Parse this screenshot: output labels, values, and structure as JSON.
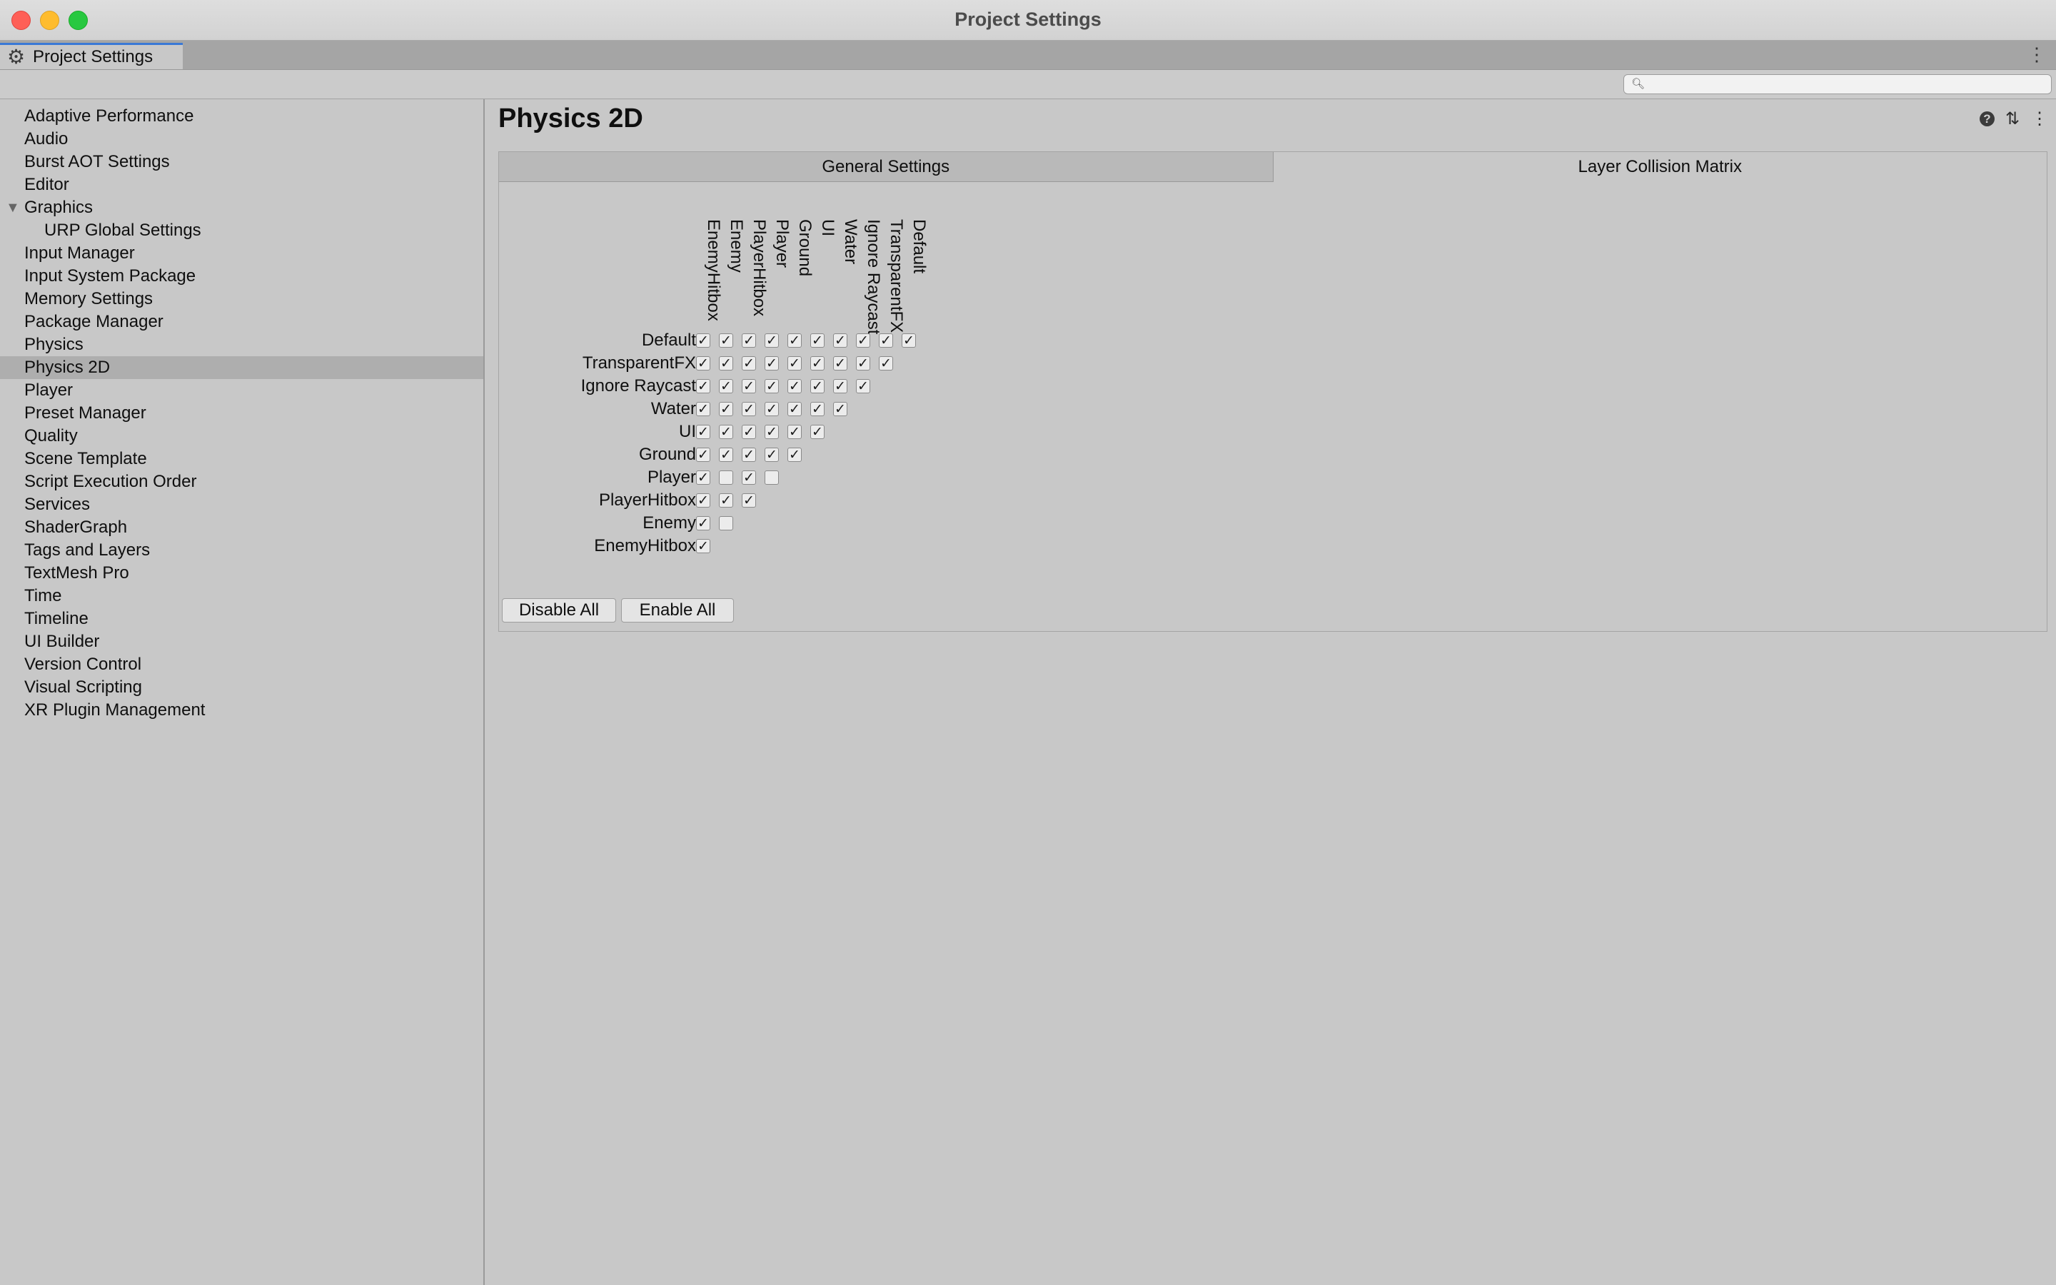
{
  "window": {
    "title": "Project Settings"
  },
  "tab": {
    "label": "Project Settings",
    "icon": "gear-icon"
  },
  "search": {
    "value": "",
    "placeholder": ""
  },
  "sidebar": {
    "items": [
      {
        "label": "Adaptive Performance",
        "level": 0
      },
      {
        "label": "Audio",
        "level": 0
      },
      {
        "label": "Burst AOT Settings",
        "level": 0
      },
      {
        "label": "Editor",
        "level": 0
      },
      {
        "label": "Graphics",
        "level": 0,
        "expanded": true
      },
      {
        "label": "URP Global Settings",
        "level": 1
      },
      {
        "label": "Input Manager",
        "level": 0
      },
      {
        "label": "Input System Package",
        "level": 0
      },
      {
        "label": "Memory Settings",
        "level": 0
      },
      {
        "label": "Package Manager",
        "level": 0
      },
      {
        "label": "Physics",
        "level": 0
      },
      {
        "label": "Physics 2D",
        "level": 0,
        "selected": true
      },
      {
        "label": "Player",
        "level": 0
      },
      {
        "label": "Preset Manager",
        "level": 0
      },
      {
        "label": "Quality",
        "level": 0
      },
      {
        "label": "Scene Template",
        "level": 0
      },
      {
        "label": "Script Execution Order",
        "level": 0
      },
      {
        "label": "Services",
        "level": 0
      },
      {
        "label": "ShaderGraph",
        "level": 0
      },
      {
        "label": "Tags and Layers",
        "level": 0
      },
      {
        "label": "TextMesh Pro",
        "level": 0
      },
      {
        "label": "Time",
        "level": 0
      },
      {
        "label": "Timeline",
        "level": 0
      },
      {
        "label": "UI Builder",
        "level": 0
      },
      {
        "label": "Version Control",
        "level": 0
      },
      {
        "label": "Visual Scripting",
        "level": 0
      },
      {
        "label": "XR Plugin Management",
        "level": 0
      }
    ]
  },
  "main": {
    "title": "Physics 2D",
    "header_icons": [
      "help-icon",
      "presets-icon",
      "more-icon"
    ],
    "tabs": [
      {
        "label": "General Settings",
        "active": false
      },
      {
        "label": "Layer Collision Matrix",
        "active": true
      }
    ],
    "matrix": {
      "layers": [
        "Default",
        "TransparentFX",
        "Ignore Raycast",
        "Water",
        "UI",
        "Ground",
        "Player",
        "PlayerHitbox",
        "Enemy",
        "EnemyHitbox"
      ],
      "columns": [
        "EnemyHitbox",
        "Enemy",
        "PlayerHitbox",
        "Player",
        "Ground",
        "UI",
        "Water",
        "Ignore Raycast",
        "TransparentFX",
        "Default"
      ],
      "rows": [
        [
          true,
          true,
          true,
          true,
          true,
          true,
          true,
          true,
          true,
          true
        ],
        [
          true,
          true,
          true,
          true,
          true,
          true,
          true,
          true,
          true
        ],
        [
          true,
          true,
          true,
          true,
          true,
          true,
          true,
          true
        ],
        [
          true,
          true,
          true,
          true,
          true,
          true,
          true
        ],
        [
          true,
          true,
          true,
          true,
          true,
          true
        ],
        [
          true,
          true,
          true,
          true,
          true
        ],
        [
          true,
          false,
          true,
          false
        ],
        [
          true,
          true,
          true
        ],
        [
          true,
          false
        ],
        [
          true
        ]
      ],
      "check_glyph": "✓"
    },
    "buttons": {
      "disable_all": "Disable All",
      "enable_all": "Enable All"
    }
  }
}
